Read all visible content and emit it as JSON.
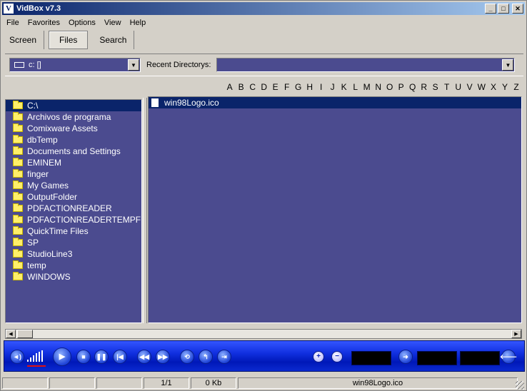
{
  "window": {
    "title": "VidBox v7.3",
    "icon_letter": "V"
  },
  "menu": [
    "File",
    "Favorites",
    "Options",
    "View",
    "Help"
  ],
  "tabs": [
    {
      "label": "Screen",
      "active": false
    },
    {
      "label": "Files",
      "active": true
    },
    {
      "label": "Search",
      "active": false
    }
  ],
  "drive": {
    "value": "c: []"
  },
  "recent": {
    "label": "Recent Directorys:",
    "value": ""
  },
  "alphabet": [
    "A",
    "B",
    "C",
    "D",
    "E",
    "F",
    "G",
    "H",
    "I",
    "J",
    "K",
    "L",
    "M",
    "N",
    "O",
    "P",
    "Q",
    "R",
    "S",
    "T",
    "U",
    "V",
    "W",
    "X",
    "Y",
    "Z"
  ],
  "tree": {
    "root": "C:\\",
    "folders": [
      "Archivos de programa",
      "Comixware Assets",
      "dbTemp",
      "Documents and Settings",
      "EMINEM",
      "finger",
      "My Games",
      "OutputFolder",
      "PDFACTIONREADER",
      "PDFACTIONREADERTEMPFI",
      "QuickTime Files",
      "SP",
      "StudioLine3",
      "temp",
      "WINDOWS"
    ]
  },
  "files": [
    {
      "name": "win98Logo.ico",
      "selected": true
    }
  ],
  "player": {
    "volume_level": 0.6,
    "buttons": [
      "speaker-icon",
      "play-icon",
      "stop-icon",
      "pause-icon",
      "skip-back-icon",
      "rewind-icon",
      "fast-forward-icon",
      "repeat-icon",
      "shuffle-back-icon",
      "shuffle-forward-icon",
      "zoom-in-icon",
      "zoom-out-icon",
      "next-icon",
      "previous-icon"
    ]
  },
  "status": {
    "cell1": "",
    "cell2": "",
    "cell3": "",
    "position": "1/1",
    "size": "0 Kb",
    "filename": "win98Logo.ico"
  },
  "colors": {
    "pane_bg": "#4b4b8f",
    "selection": "#0a246a",
    "player_blue": "#1130e0",
    "face": "#d4d0c8"
  }
}
